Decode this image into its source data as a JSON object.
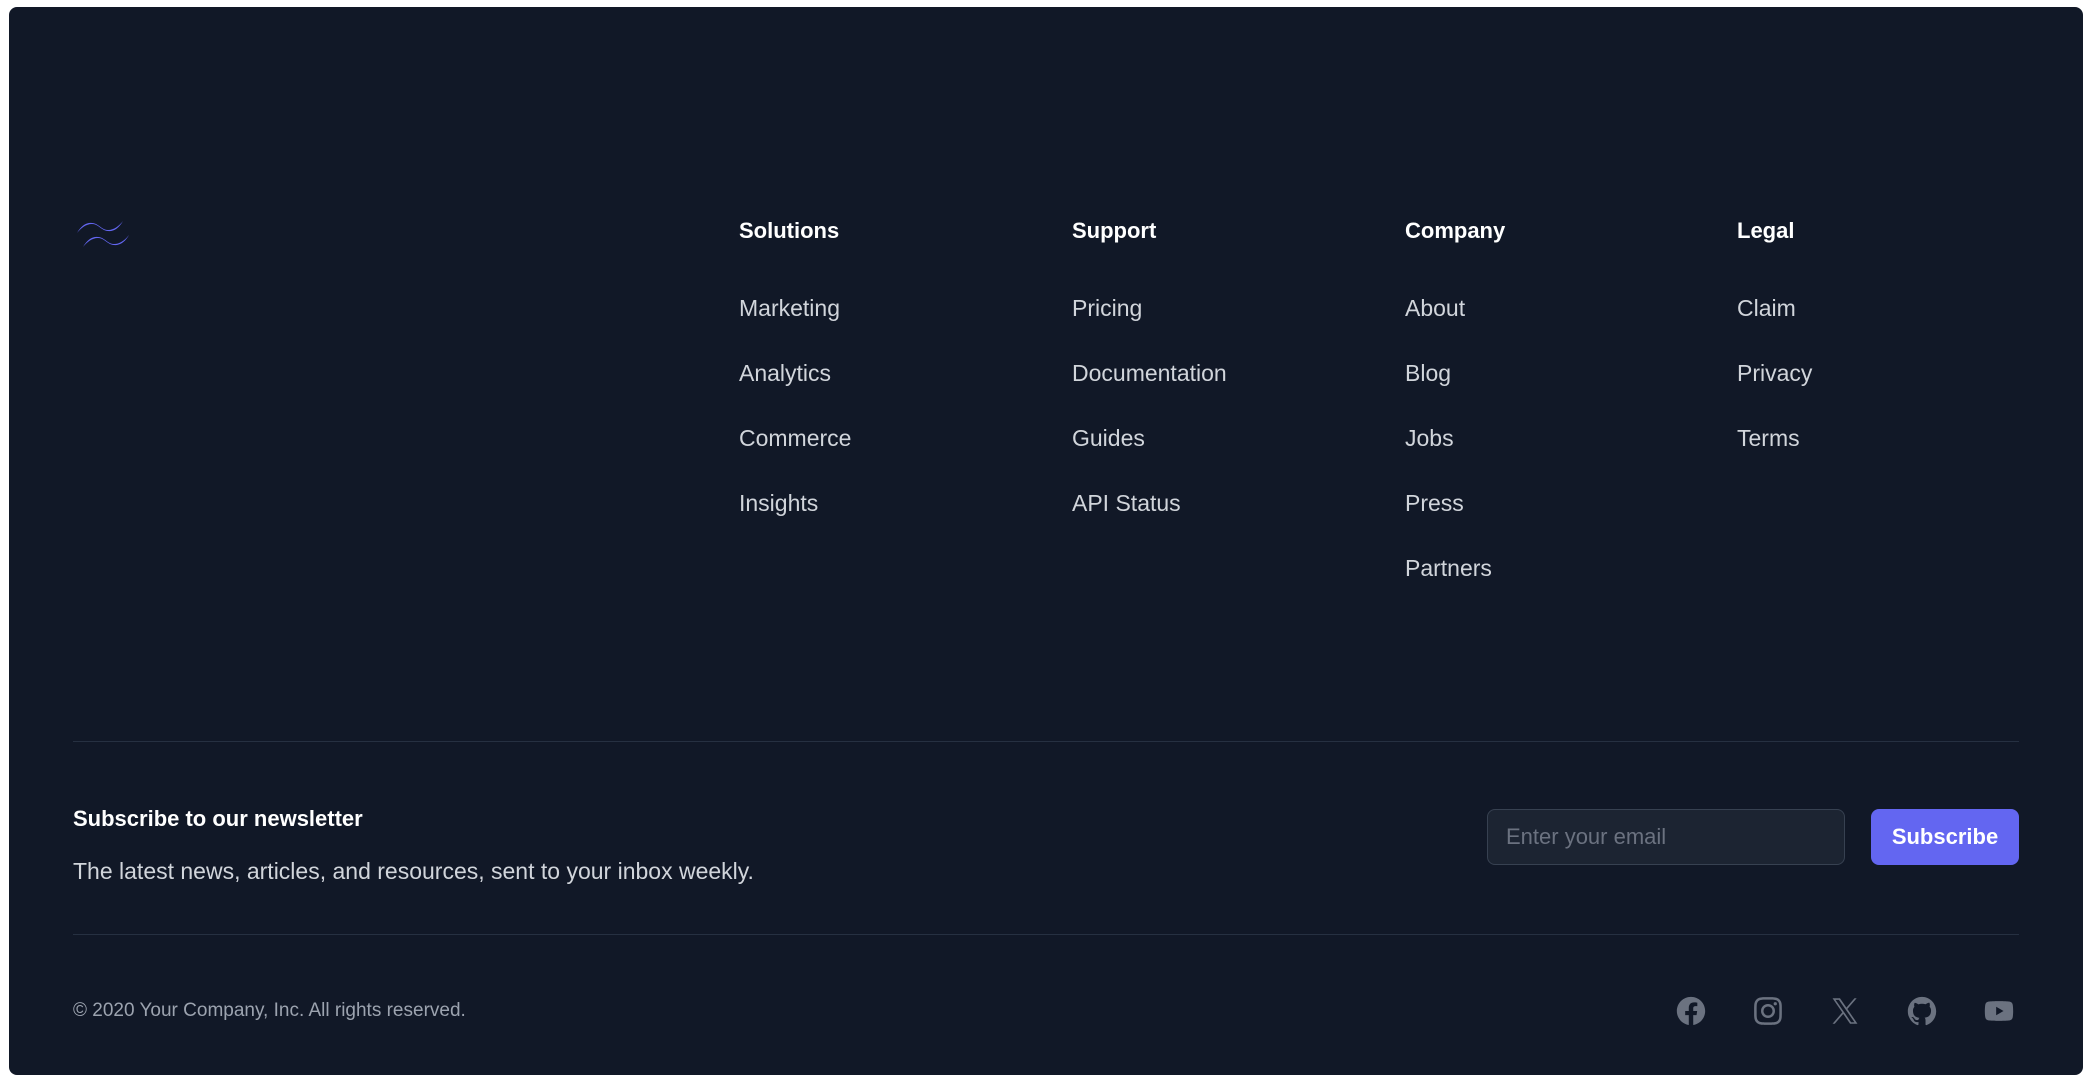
{
  "brand": {
    "logo": "tailwind-wave-logo",
    "accent": "#6366f1"
  },
  "columns": [
    {
      "title": "Solutions",
      "links": [
        "Marketing",
        "Analytics",
        "Commerce",
        "Insights"
      ]
    },
    {
      "title": "Support",
      "links": [
        "Pricing",
        "Documentation",
        "Guides",
        "API Status"
      ]
    },
    {
      "title": "Company",
      "links": [
        "About",
        "Blog",
        "Jobs",
        "Press",
        "Partners"
      ]
    },
    {
      "title": "Legal",
      "links": [
        "Claim",
        "Privacy",
        "Terms"
      ]
    }
  ],
  "newsletter": {
    "title": "Subscribe to our newsletter",
    "text": "The latest news, articles, and resources, sent to your inbox weekly.",
    "email_placeholder": "Enter your email",
    "email_value": "",
    "button_label": "Subscribe"
  },
  "copyright": "© 2020 Your Company, Inc. All rights reserved.",
  "social": [
    "facebook-icon",
    "instagram-icon",
    "x-icon",
    "github-icon",
    "youtube-icon"
  ],
  "colors": {
    "background": "#111827",
    "heading": "#ffffff",
    "link": "#d1d5db",
    "muted": "#9ca3af",
    "icon": "#6b7280"
  }
}
